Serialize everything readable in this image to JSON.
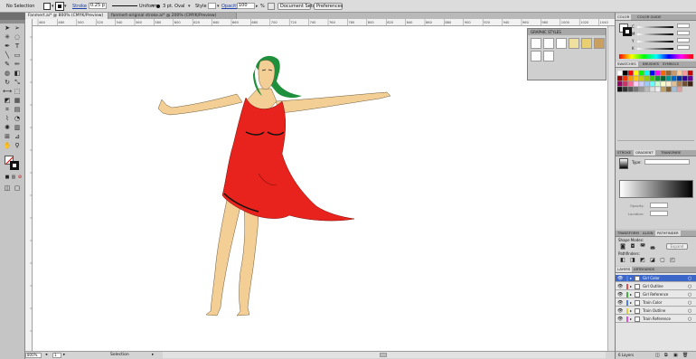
{
  "control_bar": {
    "selection_label": "No Selection",
    "stroke_label": "Stroke",
    "stroke_weight": "0.25 p",
    "profile": "Uniform",
    "brush": "3 pt. Oval",
    "style_label": "Style",
    "opacity_label": "Opacity",
    "opacity_value": "100",
    "percent": "%",
    "document_setup": "Document Setup",
    "preferences": "Preferences"
  },
  "doc_tabs": [
    {
      "label": "Fanmert.ai* @ 800% (CMYK/Preview)",
      "active": true
    },
    {
      "label": "fanmert-original stroke.ai* @ 200% (CMYK/Preview)",
      "active": false
    }
  ],
  "status_bar": {
    "zoom": "800%",
    "page": "1",
    "tool": "Selection"
  },
  "ruler_numbers": [
    "460",
    "480",
    "500",
    "520",
    "540",
    "560",
    "580",
    "600",
    "620",
    "640",
    "660",
    "680",
    "700",
    "720",
    "740",
    "760",
    "780",
    "800",
    "820",
    "840",
    "860",
    "880",
    "900",
    "920",
    "940",
    "960",
    "980",
    "1000",
    "1020",
    "1040"
  ],
  "graphic_styles": {
    "title": "GRAPHIC STYLES"
  },
  "color_panel": {
    "tabs": [
      "COLOR",
      "COLOR GUIDE"
    ],
    "channels": [
      {
        "label": "C"
      },
      {
        "label": "M"
      },
      {
        "label": "Y"
      },
      {
        "label": "K"
      }
    ]
  },
  "swatches_panel": {
    "tabs": [
      "SWATCHES",
      "BRUSHES",
      "SYMBOLS"
    ]
  },
  "gradient_panel": {
    "tabs": [
      "STROKE",
      "GRADIENT",
      "TRANSPARE"
    ],
    "type_label": "Type:",
    "opacity_label": "Opacity:",
    "location_label": "Location:"
  },
  "pathfinder_panel": {
    "tabs": [
      "TRANSFORM",
      "ALIGN",
      "PATHFINDER"
    ],
    "shape_modes_label": "Shape Modes:",
    "expand_label": "Expand",
    "pathfinders_label": "Pathfinders:"
  },
  "layers_panel": {
    "tabs": [
      "LAYERS",
      "ARTBOARDS"
    ],
    "layers": [
      {
        "name": "Girl Color",
        "color": "#4f7fe0",
        "selected": true
      },
      {
        "name": "Girl Outline",
        "color": "#e05050",
        "selected": false
      },
      {
        "name": "Girl Reference",
        "color": "#40b040",
        "selected": false
      },
      {
        "name": "Train Color",
        "color": "#4f7fe0",
        "selected": false
      },
      {
        "name": "Train Outline",
        "color": "#e0d040",
        "selected": false
      },
      {
        "name": "Train Reference",
        "color": "#e050e0",
        "selected": false
      }
    ],
    "count": "6 Layers"
  },
  "colors": {
    "dress": "#e8221c",
    "hair": "#1e8f3a",
    "skin": "#f3cf96",
    "accent": "#3c67c8"
  }
}
